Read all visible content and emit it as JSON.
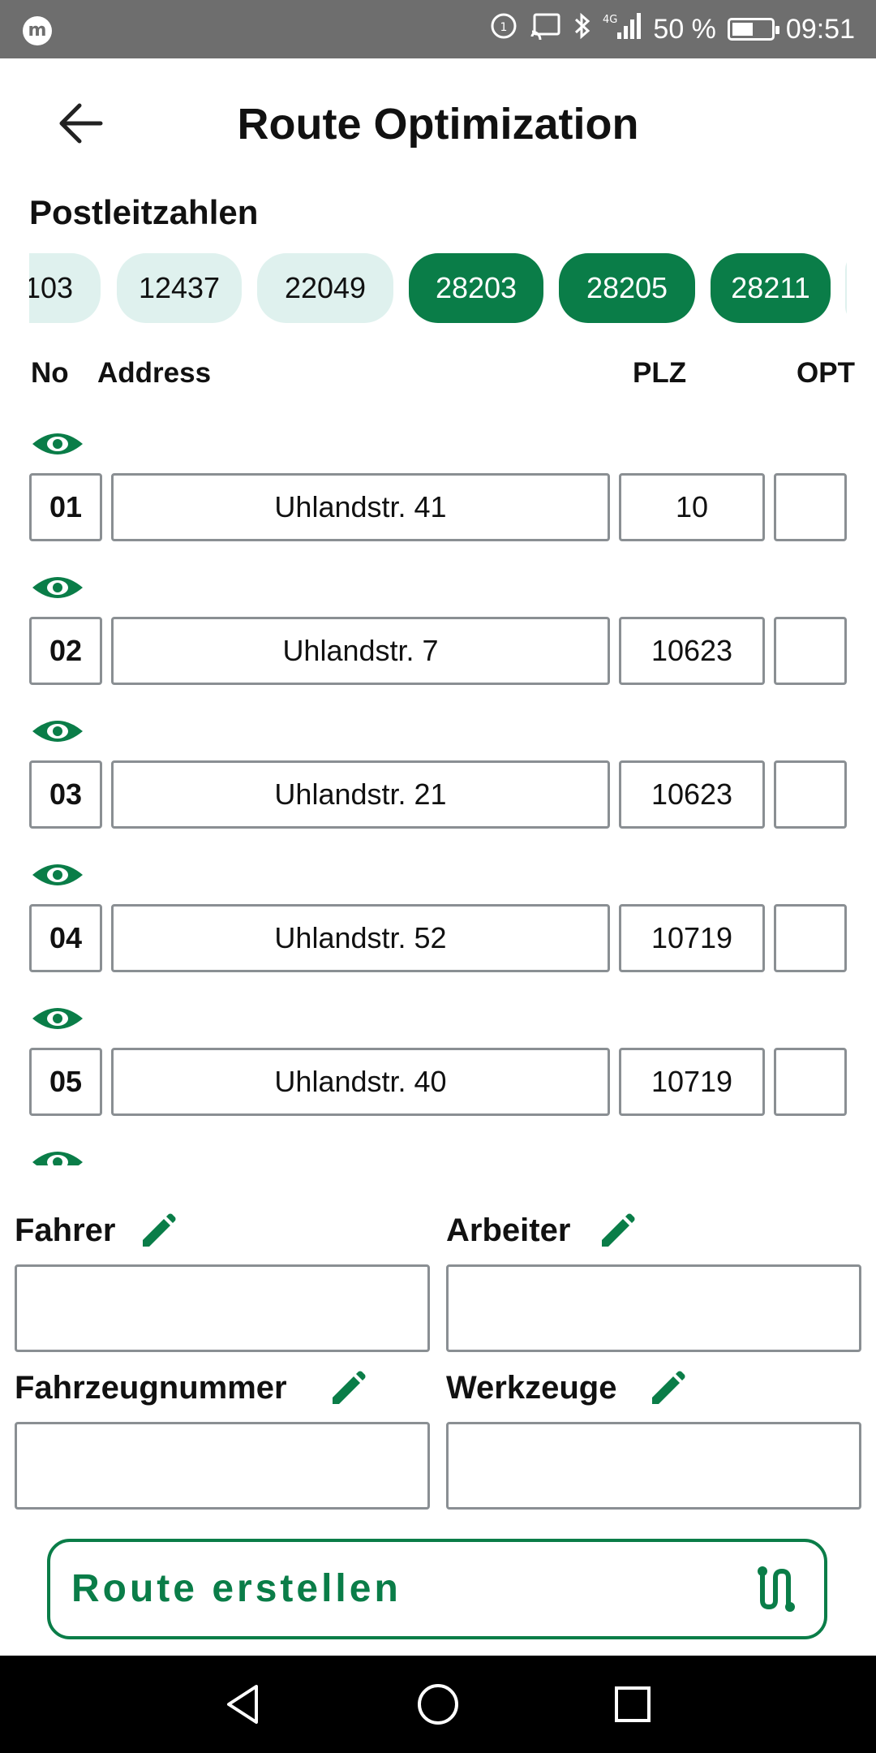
{
  "status_bar": {
    "app_badge": "m",
    "battery_percent": "50 %",
    "time": "09:51",
    "network": "4G",
    "icons": [
      "data-saver-icon",
      "cast-icon",
      "bluetooth-icon",
      "signal-icon",
      "battery-icon"
    ]
  },
  "header": {
    "title": "Route Optimization",
    "back_icon": "arrow-left-icon"
  },
  "postcodes": {
    "title": "Postleitzahlen",
    "chips": [
      {
        "label": "103",
        "selected": false
      },
      {
        "label": "12437",
        "selected": false
      },
      {
        "label": "22049",
        "selected": false
      },
      {
        "label": "28203",
        "selected": true
      },
      {
        "label": "28205",
        "selected": true
      },
      {
        "label": "28211",
        "selected": true
      }
    ]
  },
  "table": {
    "headers": {
      "no": "No",
      "address": "Address",
      "plz": "PLZ",
      "opt": "OPT"
    },
    "rows": [
      {
        "no": "01",
        "address": "Uhlandstr. 41",
        "plz": "10",
        "opt": ""
      },
      {
        "no": "02",
        "address": "Uhlandstr. 7",
        "plz": "10623",
        "opt": ""
      },
      {
        "no": "03",
        "address": "Uhlandstr. 21",
        "plz": "10623",
        "opt": ""
      },
      {
        "no": "04",
        "address": "Uhlandstr. 52",
        "plz": "10719",
        "opt": ""
      },
      {
        "no": "05",
        "address": "Uhlandstr. 40",
        "plz": "10719",
        "opt": ""
      }
    ]
  },
  "fields": {
    "fahrer": {
      "label": "Fahrer",
      "value": ""
    },
    "arbeiter": {
      "label": "Arbeiter",
      "value": ""
    },
    "fahrzeugnummer": {
      "label": "Fahrzeugnummer",
      "value": ""
    },
    "werkzeuge": {
      "label": "Werkzeuge",
      "value": ""
    }
  },
  "cta": {
    "label": "Route erstellen",
    "icon": "route-icon"
  },
  "nav": {
    "icons": [
      "back-triangle-icon",
      "home-circle-icon",
      "recents-square-icon"
    ]
  },
  "colors": {
    "accent": "#0a7d48",
    "chip_light": "#dff1ee",
    "border": "#8a8f93",
    "status_bar": "#6e6e6e"
  }
}
